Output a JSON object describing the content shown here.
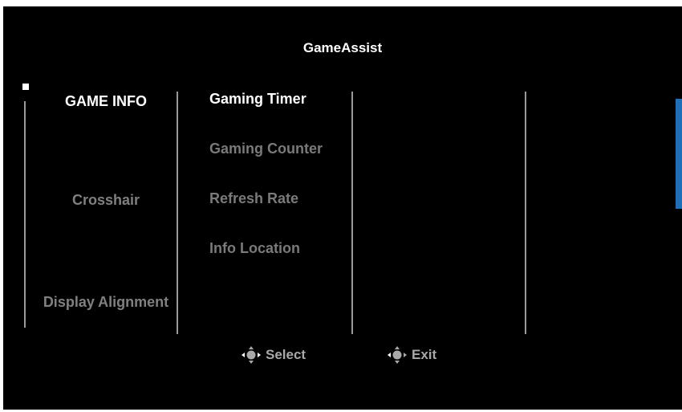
{
  "menu": {
    "title": "GameAssist",
    "categories": [
      {
        "label": "GAME INFO",
        "active": true
      },
      {
        "label": "Crosshair",
        "active": false
      },
      {
        "label": "Display Alignment",
        "active": false
      }
    ],
    "items": [
      {
        "label": "Gaming Timer",
        "active": true
      },
      {
        "label": "Gaming Counter",
        "active": false
      },
      {
        "label": "Refresh Rate",
        "active": false
      },
      {
        "label": "Info Location",
        "active": false
      }
    ]
  },
  "hints": {
    "select": {
      "label": "Select",
      "icon": "joystick-icon"
    },
    "exit": {
      "label": "Exit",
      "icon": "joystick-icon"
    }
  },
  "colors": {
    "background": "#000000",
    "active_text": "#ffffff",
    "inactive_text": "#808080",
    "accent": "#1e6fb8"
  }
}
